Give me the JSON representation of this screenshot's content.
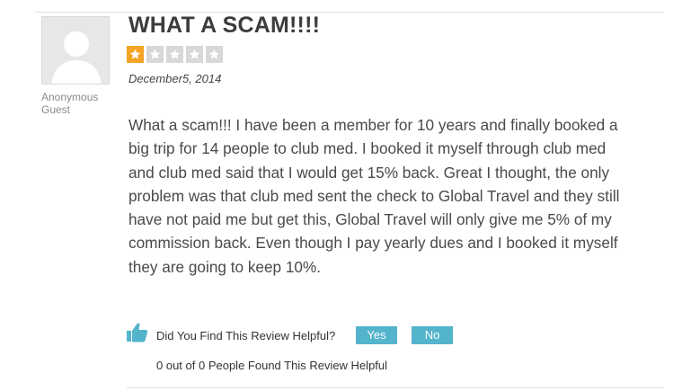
{
  "review": {
    "title": "WHAT A SCAM!!!!",
    "rating": 1,
    "max_rating": 5,
    "date": "December5, 2014",
    "reviewer_name": "Anonymous",
    "reviewer_type": "Guest",
    "body": "What a scam!!! I have been a member for 10 years and finally booked a big trip for 14 people to club med. I booked it myself through club med and club med said that I would get 15% back. Great I thought, the only problem was that club med sent the check to Global Travel and they still have not paid me but get this, Global Travel will only give me 5% of my commission back. Even though I pay yearly dues and I booked it myself they are going to keep 10%."
  },
  "helpful": {
    "question": "Did You Find This Review Helpful?",
    "yes_label": "Yes",
    "no_label": "No",
    "count_text": "0 out of 0 People Found This Review Helpful"
  },
  "icons": {
    "avatar": "user-silhouette-icon",
    "star": "star-icon",
    "thumb": "thumbs-up-icon"
  },
  "colors": {
    "star_on": "#f4a425",
    "star_off": "#d8d8d8",
    "button": "#53b4cc"
  }
}
